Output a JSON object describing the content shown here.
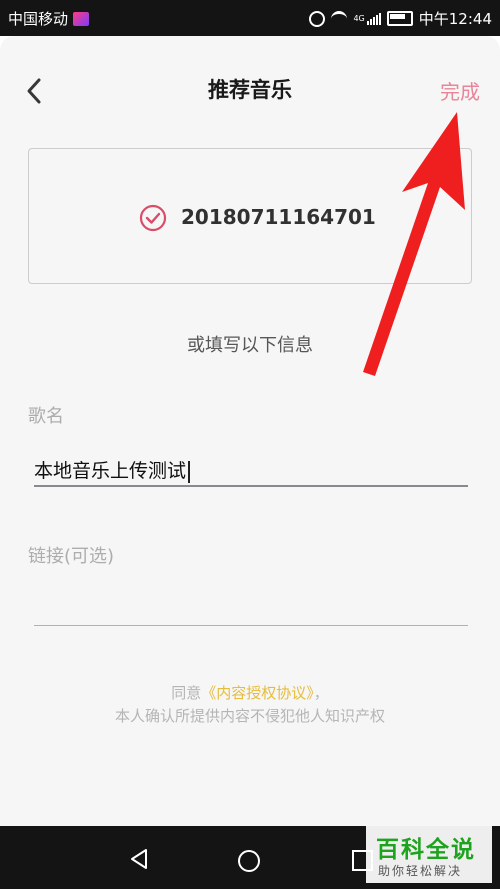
{
  "status_bar": {
    "carrier": "中国移动",
    "network_label": "4G",
    "time": "中午12:44",
    "icons": [
      "alarm-icon",
      "wifi-icon",
      "signal-icon",
      "battery-icon"
    ]
  },
  "header": {
    "title": "推荐音乐",
    "done_label": "完成",
    "back_icon": "chevron-left-icon"
  },
  "selected_music": {
    "id": "20180711164701",
    "icon": "check-circle-icon"
  },
  "divider_text": "或填写以下信息",
  "form": {
    "name_label": "歌名",
    "name_value": "本地音乐上传测试",
    "link_label": "链接(可选)",
    "link_value": ""
  },
  "agreement": {
    "prefix": "同意",
    "link_text": "《内容授权协议》",
    "suffix": "，",
    "line2": "本人确认所提供内容不侵犯他人知识产权"
  },
  "watermark": {
    "title": "百科全说",
    "subtitle": "助你轻松解决"
  },
  "colors": {
    "accent_pink": "#f08aa0",
    "check_red": "#e0506e",
    "agreement_yellow": "#efc43e",
    "arrow_red": "#ef1f1f",
    "watermark_green": "#1ea31e"
  }
}
